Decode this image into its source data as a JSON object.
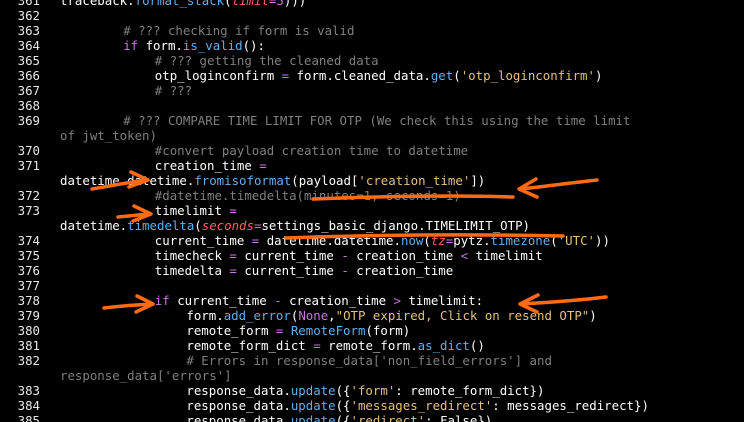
{
  "editor": {
    "annotation_color": "#ff6a13",
    "lines": [
      {
        "num": "361",
        "indent": 0,
        "tokens": [
          {
            "t": "traceback.",
            "c": "id"
          },
          {
            "t": "format_stack",
            "c": "attr"
          },
          {
            "t": "(",
            "c": "id"
          },
          {
            "t": "limit",
            "c": "kwarg"
          },
          {
            "t": "=",
            "c": "op"
          },
          {
            "t": "5",
            "c": "kw"
          },
          {
            "t": ")))",
            "c": "id"
          }
        ]
      },
      {
        "num": "362",
        "indent": 0,
        "tokens": []
      },
      {
        "num": "363",
        "indent": 8,
        "tokens": [
          {
            "t": "# ??? checking if form is valid",
            "c": "cm"
          }
        ]
      },
      {
        "num": "364",
        "indent": 8,
        "tokens": [
          {
            "t": "if ",
            "c": "kw"
          },
          {
            "t": "form.",
            "c": "id"
          },
          {
            "t": "is_valid",
            "c": "attr"
          },
          {
            "t": "():",
            "c": "id"
          }
        ]
      },
      {
        "num": "365",
        "indent": 12,
        "tokens": [
          {
            "t": "# ??? getting the cleaned data",
            "c": "cm"
          }
        ]
      },
      {
        "num": "366",
        "indent": 12,
        "tokens": [
          {
            "t": "otp_loginconfirm ",
            "c": "id"
          },
          {
            "t": "= ",
            "c": "op"
          },
          {
            "t": "form.cleaned_data.",
            "c": "id"
          },
          {
            "t": "get",
            "c": "attr"
          },
          {
            "t": "(",
            "c": "id"
          },
          {
            "t": "'otp_loginconfirm'",
            "c": "str"
          },
          {
            "t": ")",
            "c": "id"
          }
        ]
      },
      {
        "num": "367",
        "indent": 12,
        "tokens": [
          {
            "t": "# ???",
            "c": "cm"
          }
        ]
      },
      {
        "num": "368",
        "indent": 0,
        "tokens": []
      },
      {
        "num": "369",
        "indent": 8,
        "tokens": [
          {
            "t": "# ??? COMPARE TIME LIMIT FOR OTP (We check this using the time limit",
            "c": "cm"
          }
        ],
        "wrap": [
          {
            "t": "of jwt_token)",
            "c": "cm"
          }
        ]
      },
      {
        "num": "370",
        "indent": 12,
        "tokens": [
          {
            "t": "#convert payload creation time to datetime",
            "c": "cm"
          }
        ]
      },
      {
        "num": "371",
        "indent": 12,
        "tokens": [
          {
            "t": "creation_time ",
            "c": "id"
          },
          {
            "t": "=",
            "c": "op"
          }
        ],
        "wrap": [
          {
            "t": "datetime.datetime.",
            "c": "id"
          },
          {
            "t": "fromisoformat",
            "c": "attr"
          },
          {
            "t": "(payload[",
            "c": "id"
          },
          {
            "t": "'creation_time'",
            "c": "str"
          },
          {
            "t": "])",
            "c": "id"
          }
        ]
      },
      {
        "num": "372",
        "indent": 12,
        "tokens": [
          {
            "t": "#datetime.timedelta(minutes=1, seconds=1)",
            "c": "cm"
          }
        ]
      },
      {
        "num": "373",
        "indent": 12,
        "tokens": [
          {
            "t": "timelimit ",
            "c": "id"
          },
          {
            "t": "=",
            "c": "op"
          }
        ],
        "wrap": [
          {
            "t": "datetime.",
            "c": "id"
          },
          {
            "t": "timedelta",
            "c": "attr"
          },
          {
            "t": "(",
            "c": "id"
          },
          {
            "t": "seconds",
            "c": "kwarg"
          },
          {
            "t": "=",
            "c": "op"
          },
          {
            "t": "settings_basic_django.TIMELIMIT_OTP)",
            "c": "id"
          }
        ]
      },
      {
        "num": "374",
        "indent": 12,
        "tokens": [
          {
            "t": "current_time ",
            "c": "id"
          },
          {
            "t": "= ",
            "c": "op"
          },
          {
            "t": "datetime.datetime.",
            "c": "id"
          },
          {
            "t": "now",
            "c": "attr"
          },
          {
            "t": "(",
            "c": "id"
          },
          {
            "t": "tz",
            "c": "kwarg"
          },
          {
            "t": "=",
            "c": "op"
          },
          {
            "t": "pytz.",
            "c": "id"
          },
          {
            "t": "timezone",
            "c": "attr"
          },
          {
            "t": "(",
            "c": "id"
          },
          {
            "t": "'UTC'",
            "c": "str"
          },
          {
            "t": "))",
            "c": "id"
          }
        ]
      },
      {
        "num": "375",
        "indent": 12,
        "tokens": [
          {
            "t": "timecheck ",
            "c": "id"
          },
          {
            "t": "= ",
            "c": "op"
          },
          {
            "t": "current_time ",
            "c": "id"
          },
          {
            "t": "- ",
            "c": "op"
          },
          {
            "t": "creation_time ",
            "c": "id"
          },
          {
            "t": "< ",
            "c": "op"
          },
          {
            "t": "timelimit",
            "c": "id"
          }
        ]
      },
      {
        "num": "376",
        "indent": 12,
        "tokens": [
          {
            "t": "timedelta ",
            "c": "id"
          },
          {
            "t": "= ",
            "c": "op"
          },
          {
            "t": "current_time ",
            "c": "id"
          },
          {
            "t": "- ",
            "c": "op"
          },
          {
            "t": "creation_time",
            "c": "id"
          }
        ]
      },
      {
        "num": "377",
        "indent": 0,
        "tokens": []
      },
      {
        "num": "378",
        "indent": 12,
        "tokens": [
          {
            "t": "if ",
            "c": "kw"
          },
          {
            "t": "current_time ",
            "c": "id"
          },
          {
            "t": "- ",
            "c": "op"
          },
          {
            "t": "creation_time ",
            "c": "id"
          },
          {
            "t": "> ",
            "c": "op"
          },
          {
            "t": "timelimit:",
            "c": "id"
          }
        ]
      },
      {
        "num": "379",
        "indent": 16,
        "tokens": [
          {
            "t": "form.",
            "c": "id"
          },
          {
            "t": "add_error",
            "c": "attr"
          },
          {
            "t": "(",
            "c": "id"
          },
          {
            "t": "None",
            "c": "kw"
          },
          {
            "t": ",",
            "c": "id"
          },
          {
            "t": "\"OTP expired, Click on resend OTP\"",
            "c": "str"
          },
          {
            "t": ")",
            "c": "id"
          }
        ]
      },
      {
        "num": "380",
        "indent": 16,
        "tokens": [
          {
            "t": "remote_form ",
            "c": "id"
          },
          {
            "t": "= ",
            "c": "op"
          },
          {
            "t": "RemoteForm",
            "c": "attr"
          },
          {
            "t": "(form)",
            "c": "id"
          }
        ]
      },
      {
        "num": "381",
        "indent": 16,
        "tokens": [
          {
            "t": "remote_form_dict ",
            "c": "id"
          },
          {
            "t": "= ",
            "c": "op"
          },
          {
            "t": "remote_form.",
            "c": "id"
          },
          {
            "t": "as_dict",
            "c": "attr"
          },
          {
            "t": "()",
            "c": "id"
          }
        ]
      },
      {
        "num": "382",
        "indent": 16,
        "tokens": [
          {
            "t": "# Errors in response_data['non_field_errors'] and",
            "c": "cm"
          }
        ],
        "wrap": [
          {
            "t": "response_data['errors']",
            "c": "cm"
          }
        ]
      },
      {
        "num": "383",
        "indent": 16,
        "tokens": [
          {
            "t": "response_data.",
            "c": "id"
          },
          {
            "t": "update",
            "c": "attr"
          },
          {
            "t": "({",
            "c": "id"
          },
          {
            "t": "'form'",
            "c": "str"
          },
          {
            "t": ": remote_form_dict})",
            "c": "id"
          }
        ]
      },
      {
        "num": "384",
        "indent": 16,
        "tokens": [
          {
            "t": "response_data.",
            "c": "id"
          },
          {
            "t": "update",
            "c": "attr"
          },
          {
            "t": "({",
            "c": "id"
          },
          {
            "t": "'messages_redirect'",
            "c": "str"
          },
          {
            "t": ": messages_redirect})",
            "c": "id"
          }
        ]
      },
      {
        "num": "385",
        "indent": 16,
        "tokens": [
          {
            "t": "response_data.",
            "c": "id"
          },
          {
            "t": "update",
            "c": "attr"
          },
          {
            "t": "({",
            "c": "id"
          },
          {
            "t": "'redirect'",
            "c": "str"
          },
          {
            "t": ": False})",
            "c": "id"
          }
        ]
      }
    ]
  }
}
